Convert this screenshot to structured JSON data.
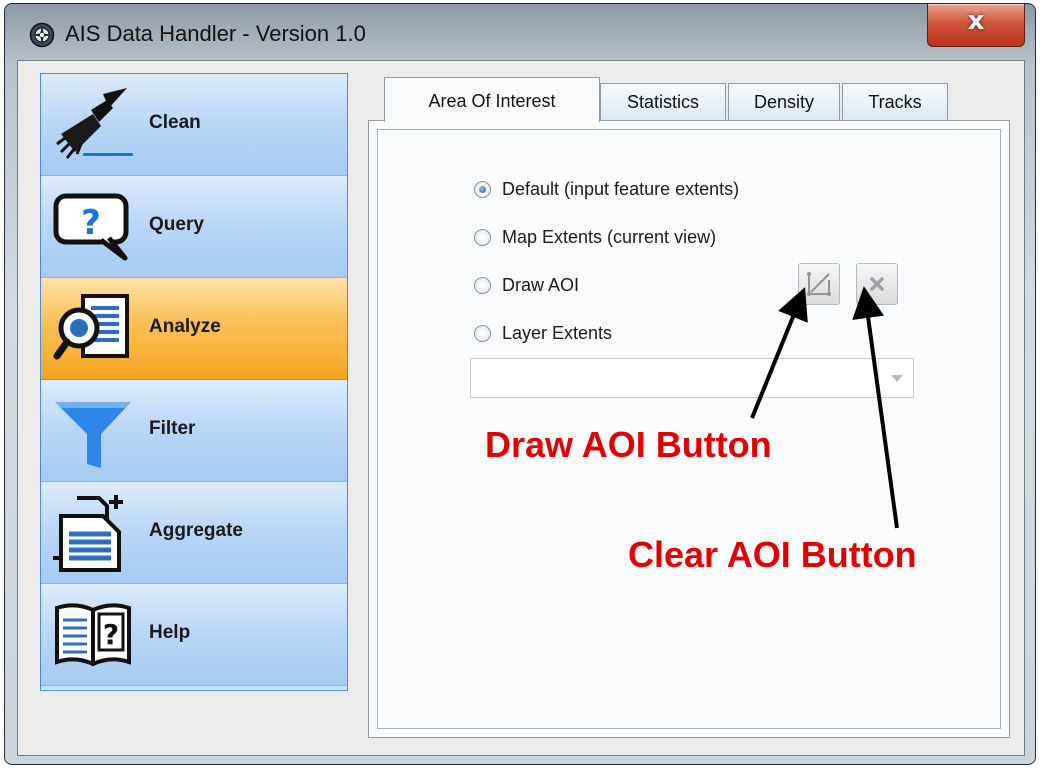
{
  "window": {
    "title": "AIS Data Handler - Version 1.0",
    "close_label": "x"
  },
  "nav": [
    {
      "label": "Clean",
      "icon": "broom-icon"
    },
    {
      "label": "Query",
      "icon": "question-bubble-icon"
    },
    {
      "label": "Analyze",
      "icon": "magnifier-document-icon",
      "active": true
    },
    {
      "label": "Filter",
      "icon": "funnel-icon"
    },
    {
      "label": "Aggregate",
      "icon": "documents-plus-icon"
    },
    {
      "label": "Help",
      "icon": "book-help-icon"
    }
  ],
  "tabs": [
    "Area Of Interest",
    "Statistics",
    "Density",
    "Tracks"
  ],
  "active_tab": "Area Of Interest",
  "aoi": {
    "options": [
      "Default (input feature extents)",
      "Map Extents (current view)",
      "Draw AOI",
      "Layer Extents"
    ],
    "selected": "Default (input feature extents)",
    "layer_dropdown_value": ""
  },
  "annotations": {
    "draw": "Draw AOI Button",
    "clear": "Clear AOI Button"
  },
  "colors": {
    "annotation": "#e00000",
    "active_nav": "#f5a423",
    "nav": "#a6cbf2"
  }
}
